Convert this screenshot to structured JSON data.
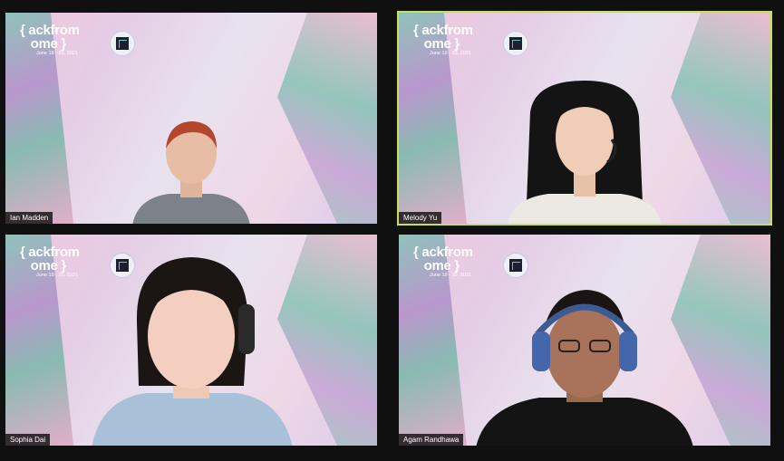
{
  "brand": {
    "wordmark": "{ ackfrom\n   ome }",
    "dates": "June 19 - 20, 2021"
  },
  "participants": [
    {
      "name": "Ian Madden"
    },
    {
      "name": "Melody Yu",
      "active_speaker": true
    },
    {
      "name": "Sophia Dai"
    },
    {
      "name": "Agam Randhawa"
    }
  ],
  "colors": {
    "active_border": "#c7e05a",
    "gallery_bg": "#101010"
  }
}
